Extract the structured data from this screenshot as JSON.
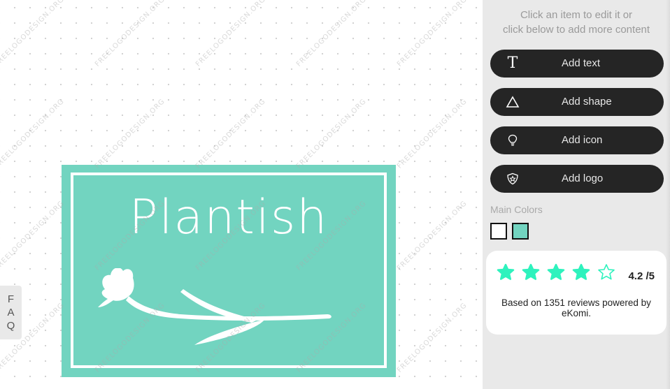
{
  "canvas": {
    "watermark_text": "FREELOGODESIGN.ORG",
    "logo": {
      "title": "Plantish",
      "background_color": "#72d4c0",
      "foreground_color": "#ffffff",
      "icon": "tulip-icon"
    },
    "faq": {
      "letters": [
        "F",
        "A",
        "Q"
      ]
    }
  },
  "sidebar": {
    "hint_line1": "Click an item to edit it or",
    "hint_line2": "click below to add more content",
    "buttons": [
      {
        "label": "Add text",
        "icon": "text-icon"
      },
      {
        "label": "Add shape",
        "icon": "triangle-icon"
      },
      {
        "label": "Add icon",
        "icon": "lightbulb-icon"
      },
      {
        "label": "Add logo",
        "icon": "shield-star-icon"
      }
    ],
    "main_colors": {
      "label": "Main Colors",
      "swatches": [
        "#ffffff",
        "#72d4c0"
      ]
    },
    "review": {
      "rating": 4.2,
      "max": 5,
      "score_text": "4.2 /5",
      "filled_stars": 4,
      "star_color": "#2ef2bd",
      "text": "Based on 1351 reviews powered by eKomi."
    }
  }
}
